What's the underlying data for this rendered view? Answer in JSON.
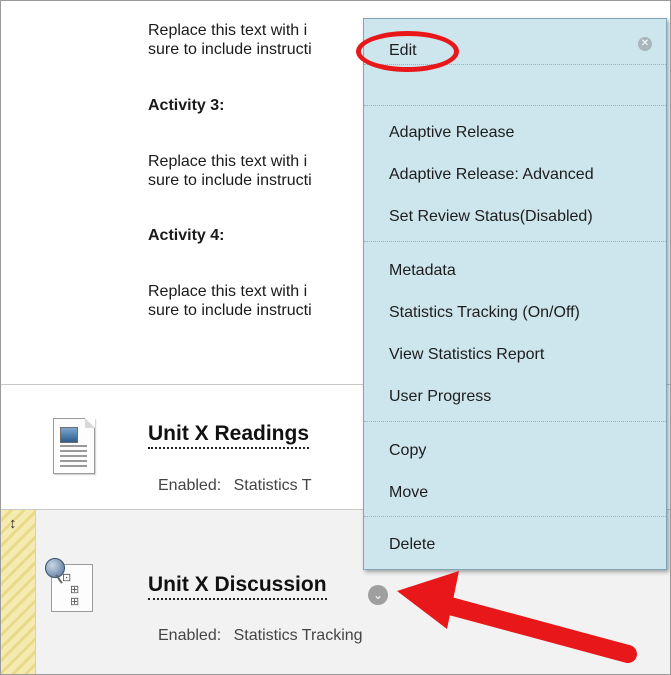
{
  "activities": {
    "text_line1": "Replace this text with i",
    "text_line2": "sure to include instructi",
    "first_line1": "Replace this text with i",
    "first_line2": "sure to include instructi",
    "activity3_heading": "Activity 3:",
    "activity3_line1": "Replace this text with i",
    "activity3_line2": "sure to include instructi",
    "activity4_heading": "Activity 4:",
    "activity4_line1": "Replace this text with i",
    "activity4_line2": "sure to include instructi"
  },
  "items": [
    {
      "title": "Unit X Readings",
      "meta_label": "Enabled:",
      "meta_value": "Statistics T"
    },
    {
      "title": "Unit X Discussion",
      "meta_label": "Enabled:",
      "meta_value": "Statistics Tracking"
    }
  ],
  "context_menu": {
    "close_icon": "close-icon",
    "items": [
      "Edit",
      "Adaptive Release",
      "Adaptive Release: Advanced",
      "Set Review Status(Disabled)",
      "Metadata",
      "Statistics Tracking (On/Off)",
      "View Statistics Report",
      "User Progress",
      "Copy",
      "Move",
      "Delete"
    ]
  },
  "colors": {
    "menu_background": "#cde5ec",
    "annotation": "#e8181a"
  }
}
